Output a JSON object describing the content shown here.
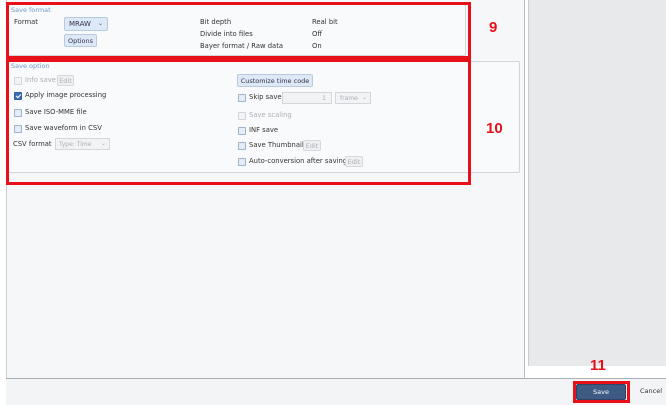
{
  "save_format": {
    "title": "Save format",
    "format_label": "Format",
    "format_value": "MRAW",
    "dropdown_icon": "chevron-down-icon",
    "options_button": "Options",
    "info": [
      {
        "label": "Bit depth",
        "value": "Real bit"
      },
      {
        "label": "Divide into files",
        "value": "Off"
      },
      {
        "label": "Bayer format / Raw data",
        "value": "On"
      }
    ]
  },
  "save_option": {
    "title": "Save option",
    "info_save": {
      "label": "Info save",
      "checked": false,
      "enabled": false,
      "edit": "Edit"
    },
    "apply_image_processing": {
      "label": "Apply image processing",
      "checked": true
    },
    "save_iso_mme": {
      "label": "Save ISO-MME file",
      "checked": false
    },
    "save_waveform_csv": {
      "label": "Save waveform in CSV",
      "checked": false
    },
    "csv_format": {
      "label": "CSV format",
      "value": "Type: Time"
    },
    "customize_time_code_button": "Customize time code",
    "skip_save": {
      "label": "Skip save",
      "checked": false,
      "value": "1",
      "unit": "frame"
    },
    "save_scaling": {
      "label": "Save scaling",
      "checked": false,
      "enabled": false
    },
    "inf_save": {
      "label": "INF save",
      "checked": false
    },
    "save_thumbnail": {
      "label": "Save Thumbnail",
      "checked": false,
      "edit": "Edit"
    },
    "auto_conversion": {
      "label": "Auto-conversion after saving",
      "checked": false,
      "edit": "Edit"
    }
  },
  "footer": {
    "save_button": "Save",
    "cancel_button": "Cancel"
  },
  "annotations": {
    "callout_9": "9",
    "callout_10": "10",
    "callout_11": "11",
    "highlight_color": "#e8111a"
  }
}
